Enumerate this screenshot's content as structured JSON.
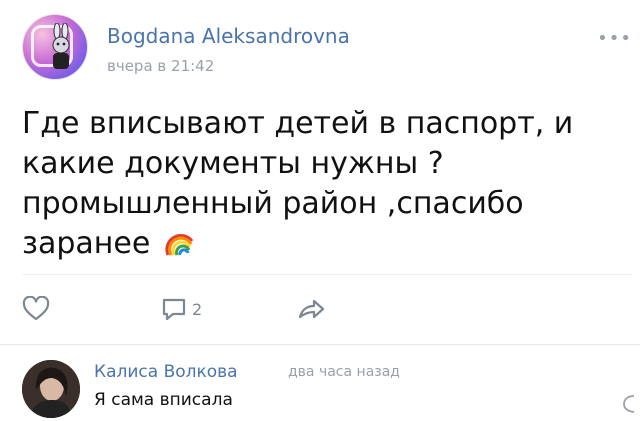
{
  "post": {
    "author": "Bogdana Aleksandrovna",
    "time": "вчера в 21:42",
    "text_lines": [
      "Где вписывают детей в паспорт, и",
      "какие документы нужны ?",
      "промышленный район ,спасибо",
      "заранее"
    ],
    "more_label": "•••",
    "comment_count": "2"
  },
  "comment": {
    "author": "Калиса Волкова",
    "time": "два часа назад",
    "text": "Я сама вписала"
  },
  "icons": {
    "avatar": "cartoon-rabbit-avatar",
    "rainbow": "rainbow-emoji",
    "like": "heart-icon",
    "comment": "comment-bubble-icon",
    "share": "share-arrow-icon",
    "reply": "reply-icon"
  },
  "colors": {
    "link_blue": "#4a74ac",
    "muted_gray": "#9aa1aa",
    "icon_gray": "#7d8794"
  }
}
